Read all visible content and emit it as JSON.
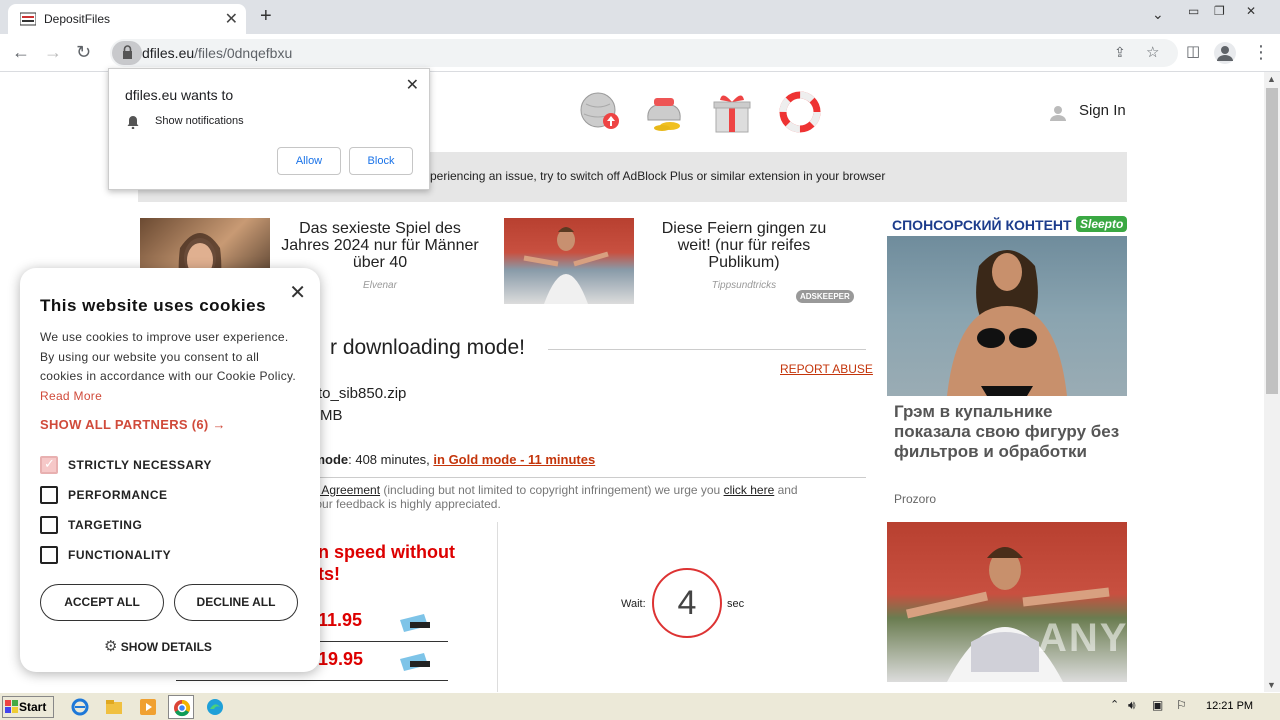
{
  "browser": {
    "tab_title": "DepositFiles",
    "url_domain": "dfiles.eu",
    "url_path": "/files/0dnqefbxu"
  },
  "notification": {
    "title": "dfiles.eu wants to",
    "message": "Show notifications",
    "allow_label": "Allow",
    "block_label": "Block"
  },
  "header": {
    "sign_in": "Sign In"
  },
  "adblock_bar": {
    "text": "xperiencing an issue, try to switch off AdBlock Plus or similar extension in your browser"
  },
  "ads": [
    {
      "title": "Das sexieste Spiel des Jahres 2024 nur für Männer über 40",
      "source": "Elvenar"
    },
    {
      "title": "Diese Feiern gingen zu weit! (nur für reifes Publikum)",
      "source": "Tippsundtricks"
    }
  ],
  "adskeeper": "ADSKEEPER",
  "download": {
    "mode_heading": "r downloading mode!",
    "report_abuse": "REPORT ABUSE",
    "filename": "to_sib850.zip",
    "filesize": "MB",
    "mode_label": "ular mode",
    "mode_time": ": 408 minutes, ",
    "gold_link": "in Gold mode - 11 minutes",
    "agree_link": "ser Agreement",
    "agree_text1": " (including but not limited to copyright infringement) we urge you ",
    "click_here": "click here",
    "agree_text2": " and",
    "agree_text3": ". Your feedback is highly appreciated."
  },
  "speed": {
    "heading_line1": "n speed without",
    "heading_line2": "ts!",
    "price1": "11.95",
    "price2": "19.95"
  },
  "timer": {
    "wait_label": "Wait:",
    "count": "4",
    "sec_label": "sec"
  },
  "sponsor": {
    "heading": "СПОНСОРСКИЙ КОНТЕНТ",
    "logo": "Sleepto",
    "article_title": "Грэм в купальнике показала свою фигуру без фильтров и обработки",
    "article_source": "Prozoro"
  },
  "cookie": {
    "title": "This website uses cookies",
    "body": "We use cookies to improve user experience. By using our website you consent to all cookies in accordance with our Cookie Policy.",
    "read_more": "Read More",
    "partners": "SHOW ALL PARTNERS (6) →",
    "options": [
      {
        "label": "STRICTLY NECESSARY",
        "checked": true
      },
      {
        "label": "PERFORMANCE",
        "checked": false
      },
      {
        "label": "TARGETING",
        "checked": false
      },
      {
        "label": "FUNCTIONALITY",
        "checked": false
      }
    ],
    "accept_all": "ACCEPT ALL",
    "decline_all": "DECLINE ALL",
    "show_details": "SHOW DETAILS"
  },
  "watermark": "ANY RUN",
  "taskbar": {
    "start_label": "Start",
    "clock": "12:21 PM"
  }
}
